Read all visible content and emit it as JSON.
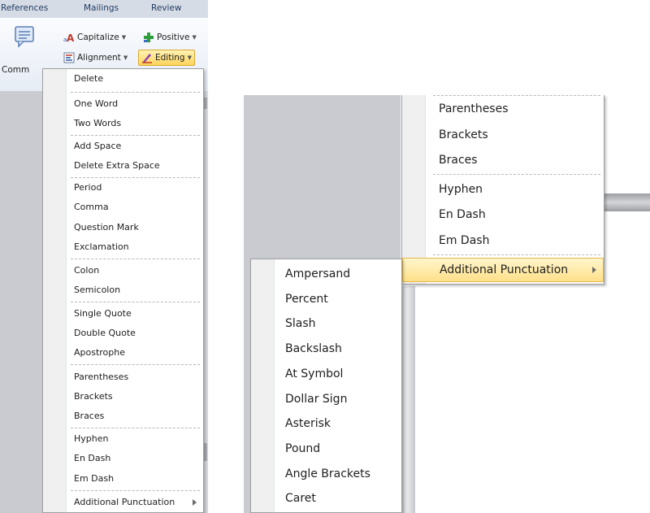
{
  "ribbon": {
    "tabs": [
      "References",
      "Mailings",
      "Review"
    ],
    "comment_label": "Comm",
    "buttons": {
      "capitalize": "Capitalize",
      "positive": "Positive",
      "alignment": "Alignment",
      "editing": "Editing"
    }
  },
  "editing_menu": {
    "items": [
      "Delete",
      "One Word",
      "Two Words",
      "Add Space",
      "Delete Extra Space",
      "Period",
      "Comma",
      "Question Mark",
      "Exclamation",
      "Colon",
      "Semicolon",
      "Single Quote",
      "Double Quote",
      "Apostrophe",
      "Parentheses",
      "Brackets",
      "Braces",
      "Hyphen",
      "En Dash",
      "Em Dash",
      "Additional Punctuation"
    ]
  },
  "zoom_menu": {
    "items": [
      "Parentheses",
      "Brackets",
      "Braces",
      "Hyphen",
      "En Dash",
      "Em Dash",
      "Additional Punctuation"
    ]
  },
  "additional_punctuation_submenu": {
    "items": [
      "Ampersand",
      "Percent",
      "Slash",
      "Backslash",
      "At Symbol",
      "Dollar Sign",
      "Asterisk",
      "Pound",
      "Angle Brackets",
      "Caret"
    ]
  },
  "icons": {
    "comment": "comment-icon",
    "capitalize": "capitalize-icon",
    "positive": "plus-icon",
    "alignment": "alignment-icon",
    "editing": "pen-icon",
    "submenu": "chevron-right-icon"
  },
  "colors": {
    "highlight_top": "#fff6cc",
    "highlight_bottom": "#ffe08a",
    "highlight_border": "#e5b849",
    "ribbon_tab_text": "#1e3a5f"
  }
}
